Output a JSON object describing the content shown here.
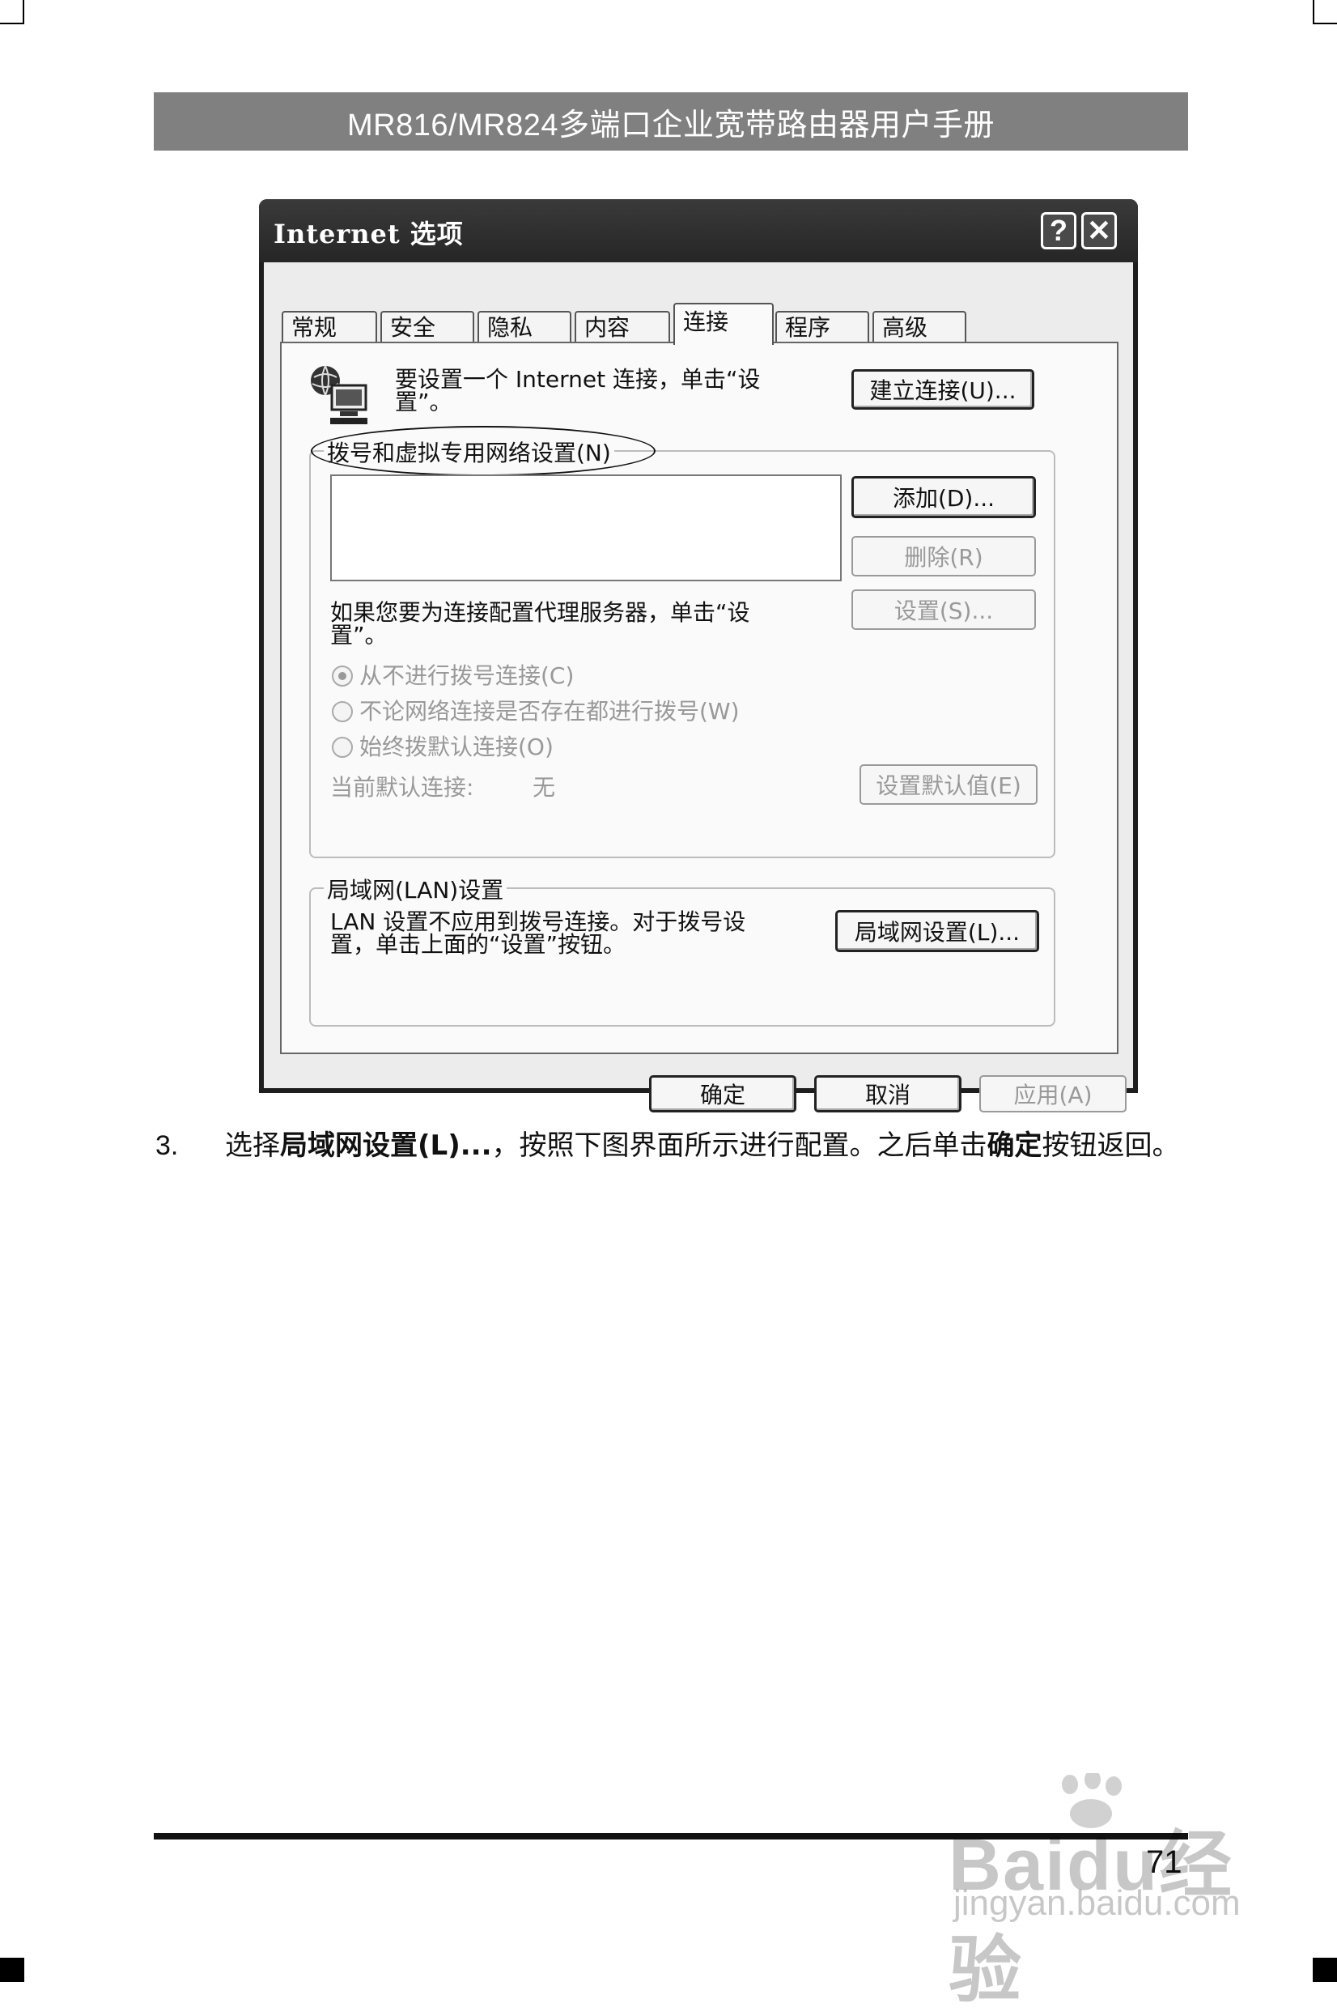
{
  "header": {
    "title": "MR816/MR824多端口企业宽带路由器用户手册"
  },
  "dialog": {
    "title": "Internet 选项",
    "help_glyph": "?",
    "close_glyph": "✕",
    "tabs": [
      "常规",
      "安全",
      "隐私",
      "内容",
      "连接",
      "程序",
      "高级"
    ],
    "setup_text_line1": "要设置一个 Internet 连接，单击“设",
    "setup_text_line2": "置”。",
    "setup_button": "建立连接(U)...",
    "dialup_group_label": "拨号和虚拟专用网络设置(N)",
    "add_button": "添加(D)...",
    "remove_button": "删除(R)",
    "settings_button": "设置(S)...",
    "proxy_text_line1": "如果您要为连接配置代理服务器，单击“设",
    "proxy_text_line2": "置”。",
    "radio_never": "从不进行拨号连接(C)",
    "radio_when_no_network": "不论网络连接是否存在都进行拨号(W)",
    "radio_always": "始终拨默认连接(O)",
    "current_default_label": "当前默认连接:",
    "current_default_value": "无",
    "set_default_button": "设置默认值(E)",
    "lan_group_label": "局域网(LAN)设置",
    "lan_text_line1": "LAN 设置不应用到拨号连接。对于拨号设",
    "lan_text_line2": "置，单击上面的“设置”按钮。",
    "lan_button": "局域网设置(L)...",
    "ok_button": "确定",
    "cancel_button": "取消",
    "apply_button": "应用(A)"
  },
  "step": {
    "number": "3.",
    "text_1": "选择",
    "bold_1": "局域网设置(L)...",
    "text_2": "，按照下图界面所示进行配置。之后单击",
    "bold_2": "确定",
    "text_3": "按钮返回。"
  },
  "footer": {
    "page_number": "71"
  },
  "watermark": {
    "brand": "Baidu经验",
    "url": "jingyan.baidu.com"
  }
}
